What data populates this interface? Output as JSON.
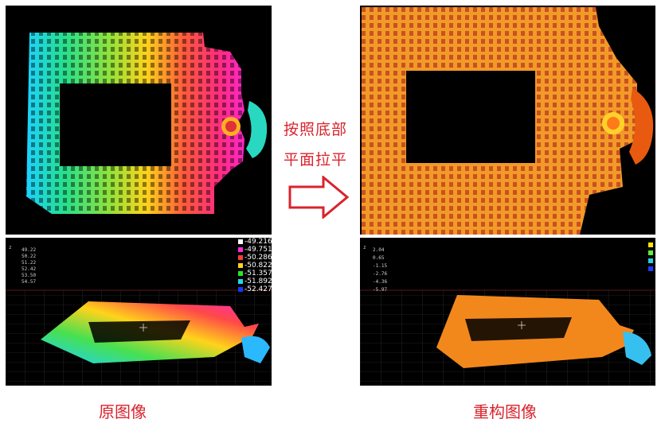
{
  "arrow_text": {
    "line1": "按照底部",
    "line2": "平面拉平"
  },
  "captions": {
    "original": "原图像",
    "reconstructed": "重构图像"
  },
  "original_3d": {
    "axis_letter": "z",
    "axis_values": [
      "49.22",
      "50.22",
      "51.22",
      "52.42",
      "53.50",
      "54.57"
    ],
    "legend": [
      {
        "label": "-49.216",
        "color": "#ffffff"
      },
      {
        "label": "-49.751",
        "color": "#ff2ad4"
      },
      {
        "label": "-50.286",
        "color": "#ff3a3a"
      },
      {
        "label": "-50.822",
        "color": "#ffd21f"
      },
      {
        "label": "-51.357",
        "color": "#26e626"
      },
      {
        "label": "-51.892",
        "color": "#23d8e8"
      },
      {
        "label": "-52.427",
        "color": "#1438ff"
      }
    ]
  },
  "reconstructed_3d": {
    "axis_letter": "z",
    "axis_values": [
      "2.04",
      "0.65",
      "-1.15",
      "-2.76",
      "-4.36",
      "-5.97"
    ],
    "legend_colors": [
      "#ffe600",
      "#5ef03a",
      "#22d3e0",
      "#1d3bff"
    ]
  }
}
